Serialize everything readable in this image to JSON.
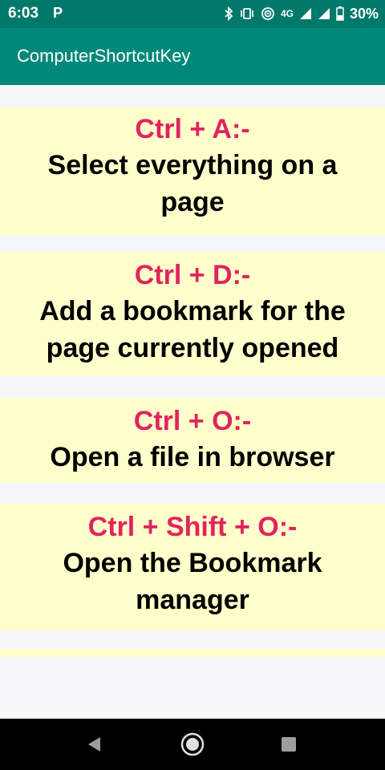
{
  "status_bar": {
    "time": "6:03",
    "notification_icon": "parking-p-icon",
    "network_label": "4G",
    "battery_percent": "30%",
    "icons": [
      "bluetooth-icon",
      "vibrate-icon",
      "hotspot-icon",
      "signal-icon",
      "signal-icon",
      "battery-icon"
    ]
  },
  "app_bar": {
    "title": "ComputerShortcutKey",
    "color": "#00897b"
  },
  "shortcuts": [
    {
      "key": "Ctrl + A:-",
      "description": "Select everything on a page"
    },
    {
      "key": "Ctrl + D:-",
      "description": "Add a bookmark for the page currently opened"
    },
    {
      "key": "Ctrl + O:-",
      "description": "Open a file in browser"
    },
    {
      "key": "Ctrl + Shift + O:-",
      "description": "Open the Bookmark manager"
    }
  ],
  "colors": {
    "card_background": "#ffffcc",
    "key_color": "#e0245e",
    "description_color": "#000000",
    "status_bar": "#00796b"
  },
  "nav_bar": {
    "icons": [
      "back-triangle-icon",
      "home-circle-icon",
      "recents-square-icon"
    ]
  }
}
